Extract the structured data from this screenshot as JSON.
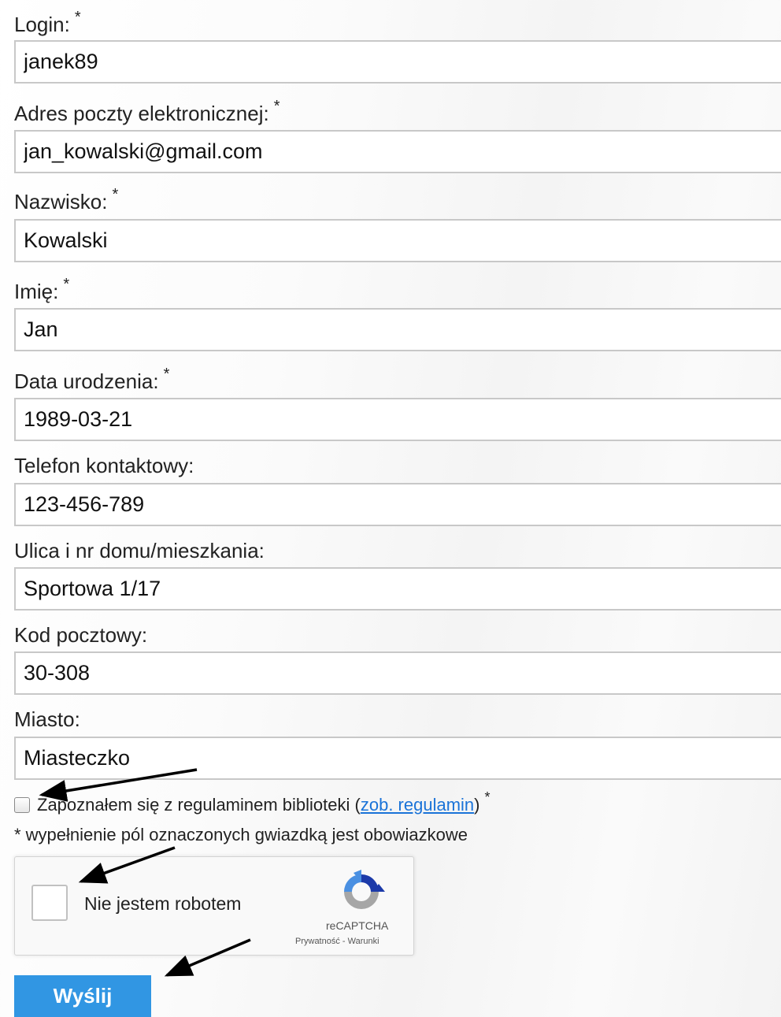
{
  "form": {
    "fields": [
      {
        "label": "Login:",
        "required_mark": "*",
        "value": "janek89"
      },
      {
        "label": "Adres poczty elektronicznej:",
        "required_mark": "*",
        "value": "jan_kowalski@gmail.com"
      },
      {
        "label": "Nazwisko:",
        "required_mark": "*",
        "value": "Kowalski"
      },
      {
        "label": "Imię:",
        "required_mark": "*",
        "value": "Jan"
      },
      {
        "label": "Data urodzenia:",
        "required_mark": "*",
        "value": "1989-03-21"
      },
      {
        "label": "Telefon kontaktowy:",
        "value": "123-456-789"
      },
      {
        "label": "Ulica i nr domu/mieszkania:",
        "value": "Sportowa 1/17"
      },
      {
        "label": "Kod pocztowy:",
        "value": "30-308"
      },
      {
        "label": "Miasto:",
        "value": "Miasteczko"
      }
    ],
    "terms": {
      "text_before": "Zapoznałem się z regulaminem biblioteki (",
      "link_text": "zob. regulamin",
      "text_after": ")",
      "required_mark": "*",
      "checked": false
    },
    "required_note": "* wypełnienie pól oznaczonych gwiazdką jest obowiazkowe",
    "recaptcha": {
      "label": "Nie jestem robotem",
      "brand": "reCAPTCHA",
      "terms": "Prywatność - Warunki",
      "checked": false
    },
    "submit_label": "Wyślij"
  },
  "colors": {
    "submit_button": "#3196e3",
    "link": "#1a73d8",
    "input_border": "#c8c8c8",
    "annotation_arrow": "#000000"
  },
  "annotations": {
    "arrow_count": 3,
    "points_to": [
      "terms-checkbox",
      "recaptcha-checkbox",
      "submit-button"
    ]
  }
}
